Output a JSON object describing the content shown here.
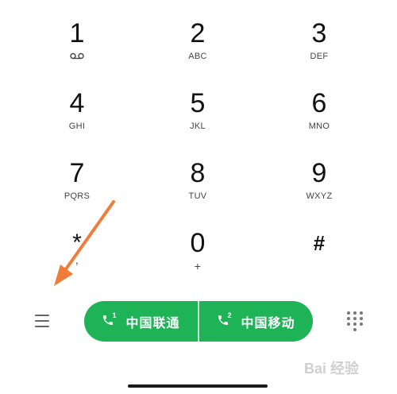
{
  "keypad": {
    "keys": [
      {
        "digit": "1",
        "letters": ""
      },
      {
        "digit": "2",
        "letters": "ABC"
      },
      {
        "digit": "3",
        "letters": "DEF"
      },
      {
        "digit": "4",
        "letters": "GHI"
      },
      {
        "digit": "5",
        "letters": "JKL"
      },
      {
        "digit": "6",
        "letters": "MNO"
      },
      {
        "digit": "7",
        "letters": "PQRS"
      },
      {
        "digit": "8",
        "letters": "TUV"
      },
      {
        "digit": "9",
        "letters": "WXYZ"
      },
      {
        "digit": "*",
        "letters": ","
      },
      {
        "digit": "0",
        "letters": "+"
      },
      {
        "digit": "#",
        "letters": ""
      }
    ]
  },
  "call_bar": {
    "sim1": {
      "label": "中国联通",
      "sim_number": "1"
    },
    "sim2": {
      "label": "中国移动",
      "sim_number": "2"
    },
    "color": "#1fb358"
  },
  "icons": {
    "key_1_icon": "voicemail-icon",
    "menu": "menu-icon",
    "dialpad": "dialpad-grid-icon",
    "call": "phone-icon"
  },
  "annotation": {
    "arrow_color": "#f07c3a"
  },
  "watermark": {
    "text": "Bai 经验"
  }
}
